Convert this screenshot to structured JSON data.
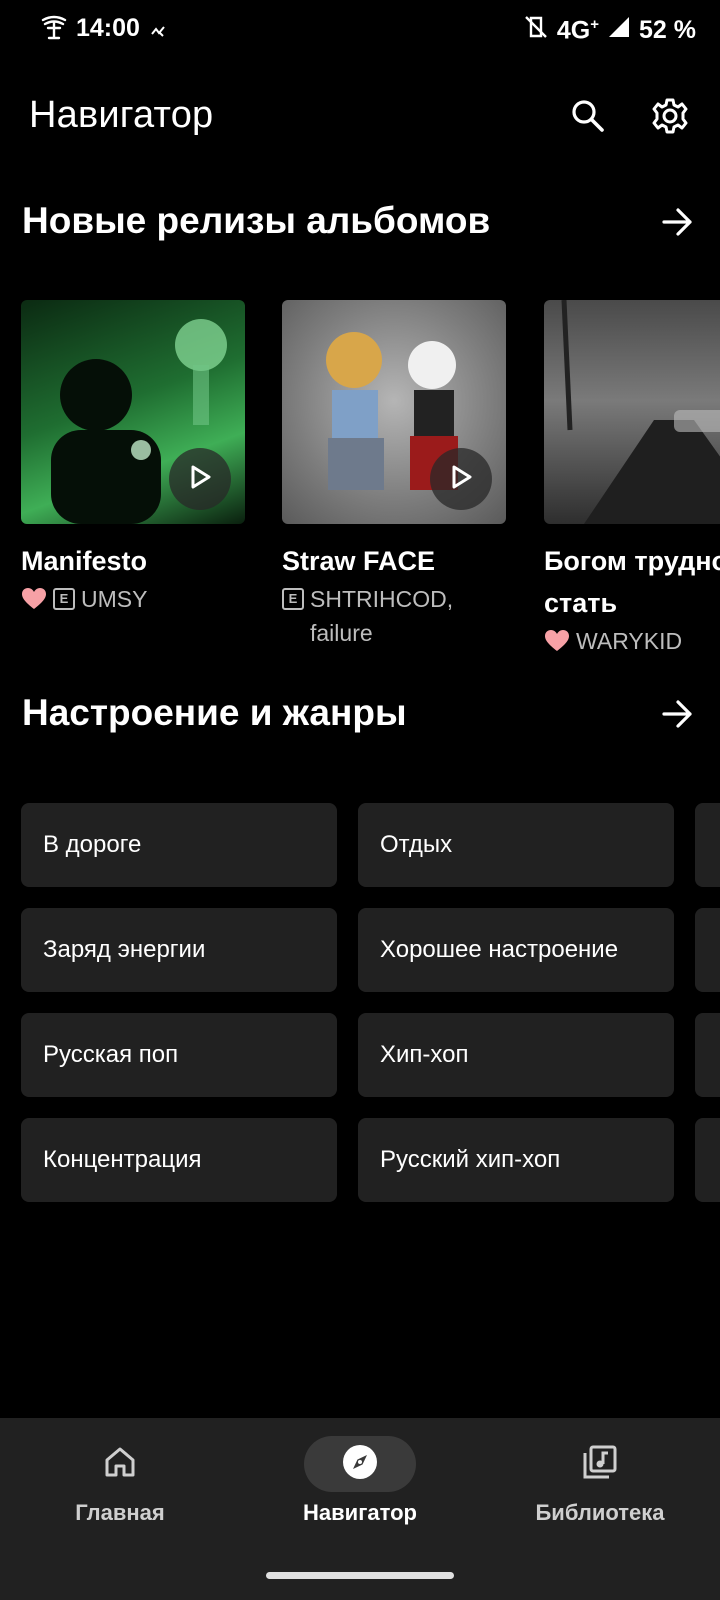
{
  "status_bar": {
    "time": "14:00",
    "network": "4G",
    "network_plus": "+",
    "battery": "52 %"
  },
  "header": {
    "title": "Навигатор",
    "icons": [
      "search-icon",
      "settings-icon"
    ]
  },
  "new_releases": {
    "title": "Новые релизы альбомов",
    "albums": [
      {
        "title": "Manifesto",
        "artist": "UMSY",
        "liked": true,
        "explicit": true,
        "cover_colors": [
          "#0b2a12",
          "#3fae56"
        ]
      },
      {
        "title": "Straw FACE",
        "artist": "SHTRIHCOD, failure",
        "liked": false,
        "explicit": true,
        "cover_colors": [
          "#6b6b6b",
          "#a8a8a8"
        ]
      },
      {
        "title": "Богом трудно стать",
        "artist": "WARYKID",
        "liked": true,
        "explicit": false,
        "cover_colors": [
          "#3d3d3d",
          "#8a8a8a"
        ]
      }
    ]
  },
  "moods": {
    "title": "Настроение и жанры",
    "items": [
      "В дороге",
      "Отдых",
      "Заряд энергии",
      "Хорошее настроение",
      "Русская поп",
      "Хип-хоп",
      "Концентрация",
      "Русский хип-хоп"
    ]
  },
  "bottom_nav": {
    "items": [
      {
        "label": "Главная",
        "icon": "home-icon",
        "active": false
      },
      {
        "label": "Навигатор",
        "icon": "compass-icon",
        "active": true
      },
      {
        "label": "Библиотека",
        "icon": "library-icon",
        "active": false
      }
    ]
  },
  "colors": {
    "background": "#000000",
    "surface": "#212121",
    "like": "#f7a1a6"
  }
}
